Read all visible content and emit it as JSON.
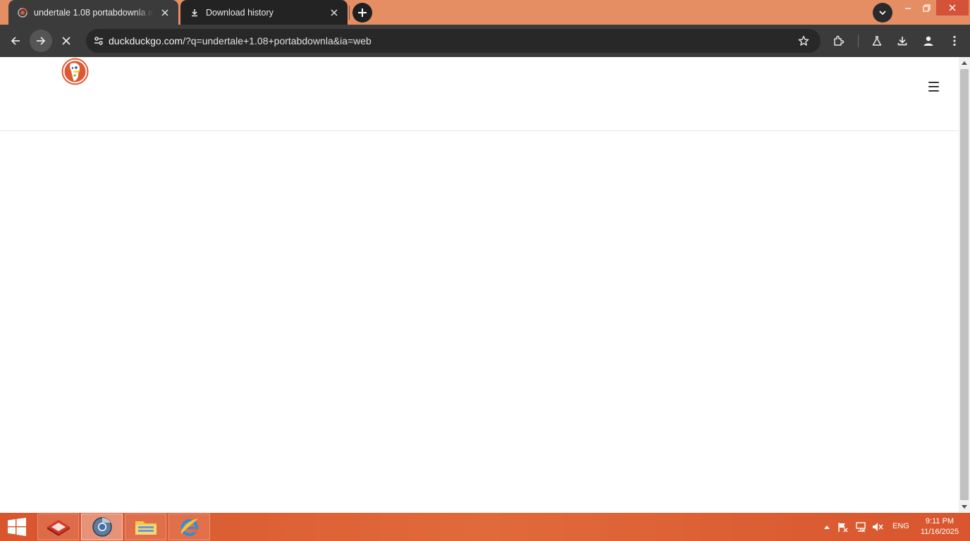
{
  "browser": {
    "tabs": [
      {
        "title": "undertale 1.08 portabdownla at",
        "favicon": "duckduckgo-loading-icon",
        "active": true
      },
      {
        "title": "Download history",
        "favicon": "download-icon",
        "active": false
      }
    ],
    "address_bar": {
      "host": "duckduckgo.com",
      "rest": "/?q=undertale+1.08+portabdownla&ia=web"
    },
    "toolbar_icons": [
      "back-icon",
      "forward-icon",
      "stop-icon",
      "site-settings-icon",
      "bookmark-star-icon",
      "extensions-icon",
      "labs-icon",
      "download-icon",
      "profile-icon",
      "more-menu-icon"
    ]
  },
  "page": {
    "site": "DuckDuckGo",
    "logo": "duckduckgo-logo",
    "menu_icon": "hamburger-menu-icon"
  },
  "taskbar": {
    "apps": [
      "app-red-icon",
      "chrome-icon",
      "file-explorer-icon",
      "internet-explorer-icon"
    ],
    "tray": {
      "language": "ENG",
      "time": "9:11 PM",
      "date": "11/16/2025"
    }
  },
  "colors": {
    "tabstrip": "#e68e63",
    "toolbar": "#3b3b3b",
    "omnibox": "#282828",
    "taskbar": "#d9552e",
    "ddg_orange": "#de5833"
  }
}
